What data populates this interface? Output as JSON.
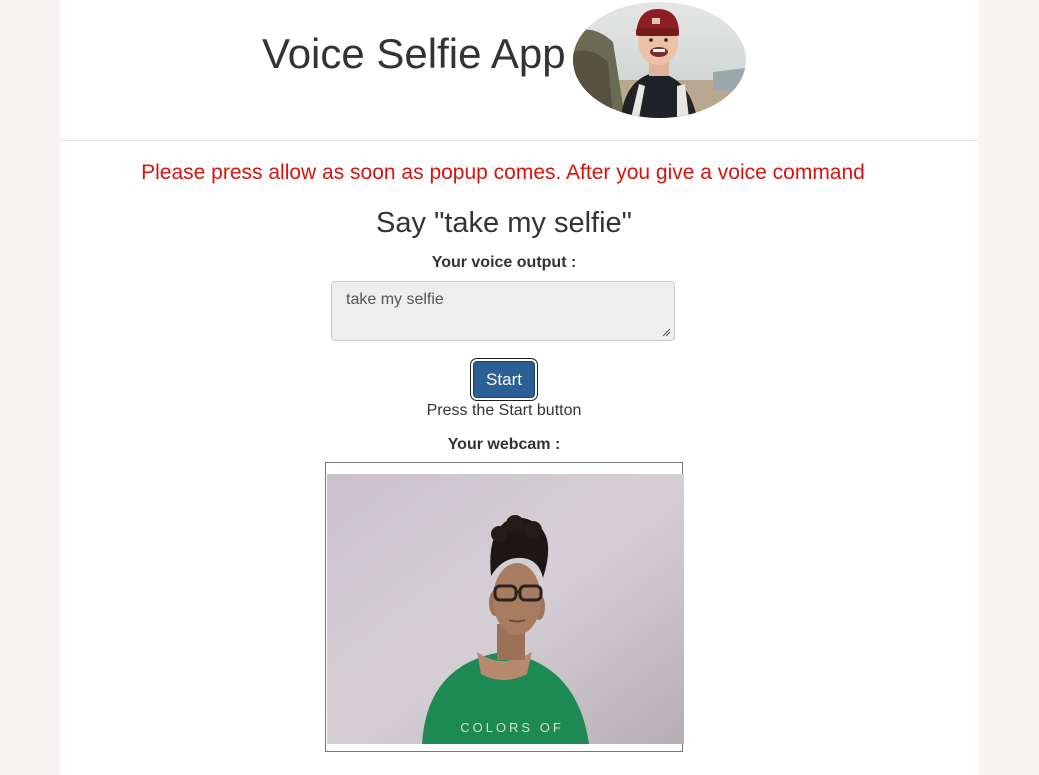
{
  "header": {
    "title": "Voice Selfie App",
    "avatar_icon": "selfie-portrait-image"
  },
  "notice": {
    "text": "Please press allow as soon as popup comes. After you give a voice command",
    "color": "#d9140f"
  },
  "instruction": {
    "text": "Say \"take my selfie\""
  },
  "voice_output": {
    "label": "Your voice output :",
    "value": "take my selfie"
  },
  "controls": {
    "start_label": "Start",
    "start_color": "#2b6096",
    "status": "Press the Start button"
  },
  "webcam": {
    "label": "Your webcam :",
    "shirt_text": "COLORS OF"
  }
}
